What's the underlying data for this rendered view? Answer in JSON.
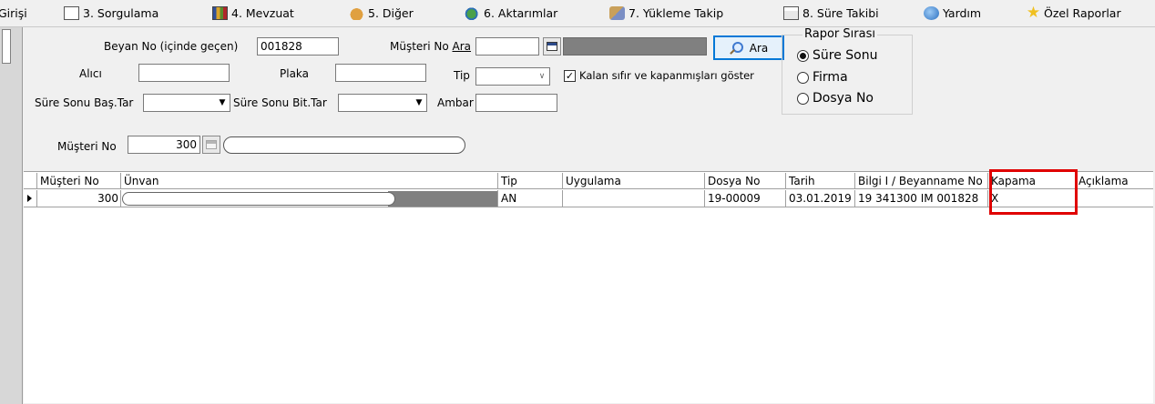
{
  "menu": [
    {
      "label": "Girişi",
      "icon": ""
    },
    {
      "label": "3. Sorgulama",
      "icon": "query-icon"
    },
    {
      "label": "4. Mevzuat",
      "icon": "books-icon"
    },
    {
      "label": "5. Diğer",
      "icon": "bag-icon"
    },
    {
      "label": "6. Aktarımlar",
      "icon": "transfer-gear-icon"
    },
    {
      "label": "7. Yükleme Takip",
      "icon": "tracking-icon"
    },
    {
      "label": "8. Süre Takibi",
      "icon": "calendar-icon"
    },
    {
      "label": "Yardım",
      "icon": "help-icon"
    },
    {
      "label": "Özel Raporlar",
      "icon": "star-icon"
    }
  ],
  "filters": {
    "beyan_no_label": "Beyan No (içinde geçen)",
    "beyan_no_value": "001828",
    "musteri_no_ara_label": "Müşteri No Ara",
    "alici_label": "Alıcı",
    "alici_value": "",
    "plaka_label": "Plaka",
    "plaka_value": "",
    "tip_label": "Tip",
    "tip_value": "",
    "kalan_checkbox_label": "Kalan sıfır ve kapanmışları göster",
    "kalan_checked": true,
    "sure_sonu_bas_label": "Süre Sonu Baş.Tar",
    "sure_sonu_bit_label": "Süre Sonu Bit.Tar",
    "ambar_label": "Ambar",
    "ambar_value": "",
    "ara_button": "Ara"
  },
  "rapor_sirasi": {
    "title": "Rapor Sırası",
    "options": [
      "Süre Sonu",
      "Firma",
      "Dosya No"
    ],
    "selected": "Süre Sonu"
  },
  "musteri": {
    "label": "Müşteri No",
    "value": "300"
  },
  "grid": {
    "columns": [
      "Müşteri No",
      "Ünvan",
      "Tip",
      "Uygulama",
      "Dosya No",
      "Tarih",
      "Bilgi I / Beyanname No",
      "Kapama",
      "Açıklama"
    ],
    "rows": [
      {
        "musteri_no": "300",
        "unvan": "",
        "tip": "AN",
        "uygulama": "",
        "dosya_no": "19-00009",
        "tarih": "03.01.2019",
        "beyanname_no": "19 341300 IM 001828",
        "kapama": "X",
        "aciklama": ""
      }
    ]
  },
  "colors": {
    "highlight": "#e00000",
    "focus": "#0078d7"
  }
}
